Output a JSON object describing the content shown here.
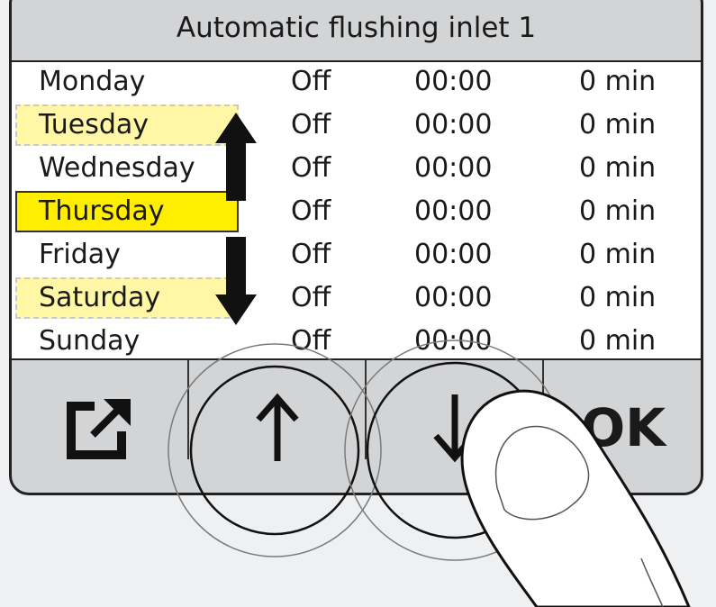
{
  "screen": {
    "title": "Automatic flushing inlet 1",
    "rows": [
      {
        "day": "Monday",
        "state": "Off",
        "time": "00:00",
        "duration": "0 min"
      },
      {
        "day": "Tuesday",
        "state": "Off",
        "time": "00:00",
        "duration": "0 min"
      },
      {
        "day": "Wednesday",
        "state": "Off",
        "time": "00:00",
        "duration": "0 min"
      },
      {
        "day": "Thursday",
        "state": "Off",
        "time": "00:00",
        "duration": "0 min"
      },
      {
        "day": "Friday",
        "state": "Off",
        "time": "00:00",
        "duration": "0 min"
      },
      {
        "day": "Saturday",
        "state": "Off",
        "time": "00:00",
        "duration": "0 min"
      },
      {
        "day": "Sunday",
        "state": "Off",
        "time": "00:00",
        "duration": "0 min"
      }
    ],
    "selected_day": "Thursday",
    "softkeys": {
      "back_icon": "exit-icon",
      "up_icon": "arrow-up-icon",
      "down_icon": "arrow-down-icon",
      "ok_label": "OK"
    }
  },
  "colors": {
    "selected": "#ffee00",
    "neighbor_highlight": "#fff7a6",
    "bezel": "#d3d4d6",
    "list_background": "#ffffff"
  }
}
